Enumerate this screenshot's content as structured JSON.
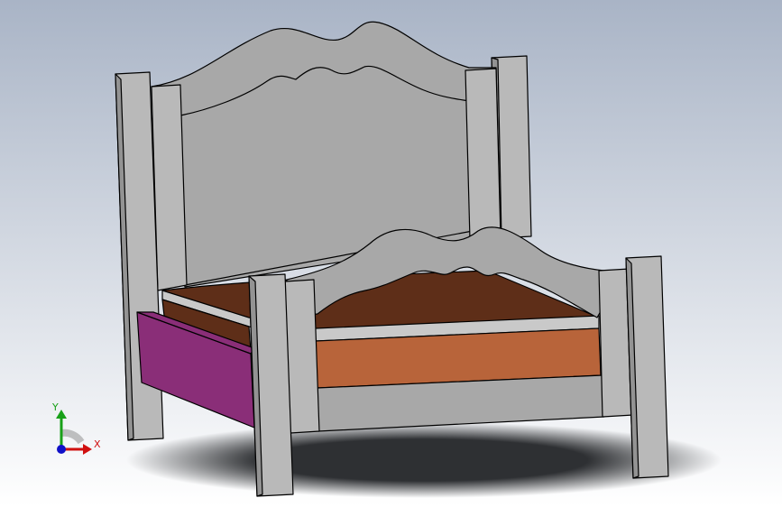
{
  "viewport": {
    "background_top": "#a9b4c6",
    "background_bottom": "#ffffff",
    "shadow_color": "#2e3033"
  },
  "model": {
    "frame_color": "#a8a8a8",
    "frame_dark": "#939393",
    "frame_light": "#b9b9b9",
    "outline_color": "#000000",
    "mattress_top": "#5e2e18",
    "mattress_side": "#b8643a",
    "mattress_edge": "#c9c9c9",
    "drawer_color": "#8a2e78"
  },
  "triad": {
    "x_label": "X",
    "y_label": "Y",
    "x_color": "#d01010",
    "y_color": "#18a018",
    "z_color": "#1010c8"
  }
}
